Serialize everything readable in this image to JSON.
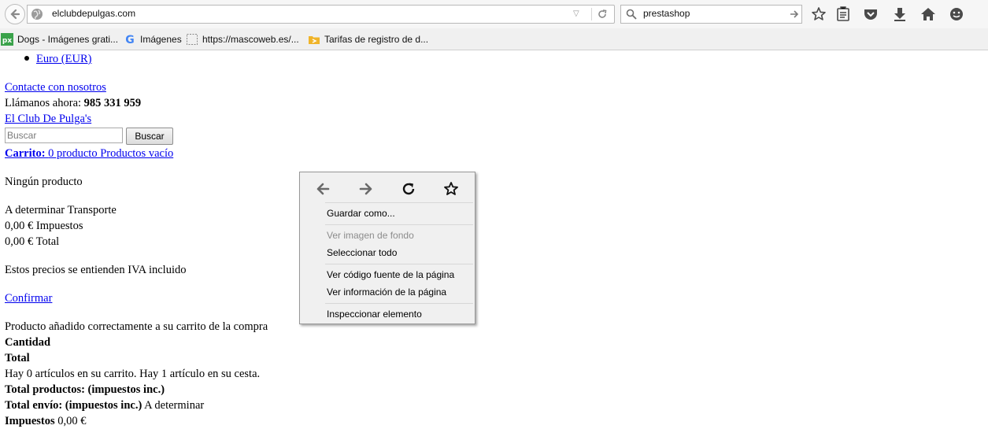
{
  "browser": {
    "url": "elclubdepulgas.com",
    "search_query": "prestashop",
    "bookmarks": [
      {
        "label": "Dogs - Imágenes grati...",
        "icon": "px-icon"
      },
      {
        "label": "Imágenes",
        "icon": "google-icon"
      },
      {
        "label": "https://mascoweb.es/...",
        "icon": "blank-page-icon"
      },
      {
        "label": "Tarifas de registro de d...",
        "icon": "folder-arrow-icon"
      }
    ]
  },
  "page": {
    "currency": "Euro (EUR)",
    "contact": "Contacte con nosotros",
    "call_label": "Llámanos ahora:",
    "phone": "985 331 959",
    "shop_name": "El Club De Pulga's",
    "search_placeholder": "Buscar",
    "search_button": "Buscar",
    "cart_label": "Carrito:",
    "cart_info": "0 producto Productos vacío",
    "no_product": "Ningún producto",
    "shipping_value": "A determinar",
    "shipping_label": "Transporte",
    "tax_value": "0,00 €",
    "tax_label": "Impuestos",
    "total_value": "0,00 €",
    "total_label": "Total",
    "vat_note": "Estos precios se entienden IVA incluido",
    "confirm": "Confirmar",
    "added_msg": "Producto añadido correctamente a su carrito de la compra",
    "quantity_label": "Cantidad",
    "total_heading": "Total",
    "cart_count_msg": "Hay 0 artículos en su carrito. Hay 1 artículo en su cesta.",
    "total_products_label": "Total productos: (impuestos inc.)",
    "total_shipping_label": "Total envío: (impuestos inc.)",
    "total_shipping_value": "A determinar",
    "taxes_label": "Impuestos",
    "taxes_value": "0,00 €"
  },
  "context_menu": {
    "items": [
      {
        "label": "Guardar como...",
        "enabled": true
      },
      {
        "label": "Ver imagen de fondo",
        "enabled": false
      },
      {
        "label": "Seleccionar todo",
        "enabled": true
      },
      {
        "label": "Ver código fuente de la página",
        "enabled": true
      },
      {
        "label": "Ver información de la página",
        "enabled": true
      },
      {
        "label": "Inspeccionar elemento",
        "enabled": true
      }
    ]
  }
}
